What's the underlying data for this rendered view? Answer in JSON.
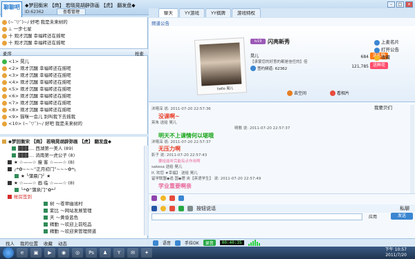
{
  "window": {
    "logo_text": "聊聊吧",
    "title": "◆梦回衡宋 【商】 若晓晃胡辟弥画 【虎】 翻发盘◆",
    "room_id": "ID:62362",
    "manage_button": "查看管理"
  },
  "left": {
    "top_users": [
      "(~¯▽¯)~/ 好吧 我是未来树的",
      "⊥ 一步七星",
      "十 观才沉醒 幸福砖还在摇呢",
      "十 观才沉醒 幸福砖还在摇呢"
    ],
    "mic_label": "麦序",
    "mic_queue_label": "抢麦",
    "mic_list": [
      "<1> 晃儿",
      "<2> 观才沉醒 幸福砖还在摇呢",
      "<3> 观才沉醒 幸福砖还在摇呢",
      "<4> 观才沉醒 幸福砖还在摇呢",
      "<5> 观才沉醒 幸福砖还在摇呢",
      "<6> 观才沉醒 幸福砖还在摇呢",
      "<7> 观才沉醒 幸福砖还在摇呢",
      "<8> 观才沉醒 幸福砖还在摇呢",
      "<9> 猫咪一会儿 别叫我下去摇我",
      "<10> (~¯▽¯)~/ 好吧 我是未来树的"
    ],
    "tree": [
      "◆梦回衡宋 【商】 若晓晃胡辟弥画 【虎】 翻发盘◆",
      "▓▓▓.... 西湖第一美人 (89)",
      "▓▓▓.... 淌南第一虎公子 (8)",
      "★ ☆——☆ 瘦 客 ☆——☆ (8)",
      "╭*✿~~~“正月初门”~~~✿*╮",
      "★ ╰蒲晨门╯ ★",
      "★ ☆——☆ 画 临 ☆——☆ (8)",
      "╰*✿“蒲泉门”✿*╯",
      "帐房签到",
      "树 ～苍翠幽谧村",
      "紫比 ～网站发展管理",
      "天 ～黄昏蓝色",
      "精勤 ～欢迎上前吃品",
      "精勤 ～欢迎来管理频道"
    ],
    "bottom_tabs": [
      "找人",
      "我的位置",
      "收藏",
      "动态"
    ]
  },
  "right": {
    "tabs": [
      "聊天",
      "YY游戏",
      "YY棋牌",
      "游戏特权"
    ],
    "announcement": "频道公告",
    "profile": {
      "level": "lv19",
      "nickname": "闪亮新秀",
      "name": "晃儿",
      "signature": "【承蒙您的好意的都是信任的】倍",
      "sign_in": "签约频道: 62362",
      "points": "684",
      "contribution": "121,785",
      "gift_button": "送礼物",
      "flower_button": "送鲜花",
      "space_button": "去空间",
      "photo_button": "看相片",
      "photo_caption": "hello 晃儿",
      "side_links": [
        "上麦名片",
        "打开公告",
        "收藏"
      ],
      "my_space": "我要贝们"
    },
    "chat": [
      {
        "text": "沐嘻深 说: 2011-07-20 22:57:36",
        "style": ""
      },
      {
        "text": "没课啊~",
        "style": "big red"
      },
      {
        "text": "英朱 送给 晃儿",
        "style": ""
      },
      {
        "text": "晴歌 说: 2011-07-20 22:57:37",
        "style": ""
      },
      {
        "text": "明天不上课情何以堪哦",
        "style": "big green"
      },
      {
        "text": "沐嘻深 说: 2011-07-20 22:57:37",
        "style": ""
      },
      {
        "text": "无压力啊",
        "style": "big red"
      },
      {
        "text": "影子 说: 2011-07-20 22:57:43",
        "style": ""
      },
      {
        "text": "要给能听完能有点作用啊",
        "style": "pink"
      },
      {
        "text": "sakesa 送给 晃儿",
        "style": ""
      },
      {
        "text": "If, 欢您 ★幸福】 送给 晃儿",
        "style": ""
      },
      {
        "text": "留学联盟◆逃 国◆理 央【英语学生】 说: 2011-07-20 22:57:49",
        "style": ""
      },
      {
        "text": "学业重要啊亲",
        "style": "big pink"
      }
    ],
    "toolbar_mode": "按钮说话",
    "private_label": "私聊",
    "app_label": "应用",
    "send_button": "发送"
  },
  "statusbar": {
    "mic_label": "语音",
    "hand_label": "手拉OK",
    "record_label": "录音",
    "timer": "00:40:35"
  },
  "taskbar": {
    "time": "下午 10:57",
    "date": "2011/7/20"
  }
}
